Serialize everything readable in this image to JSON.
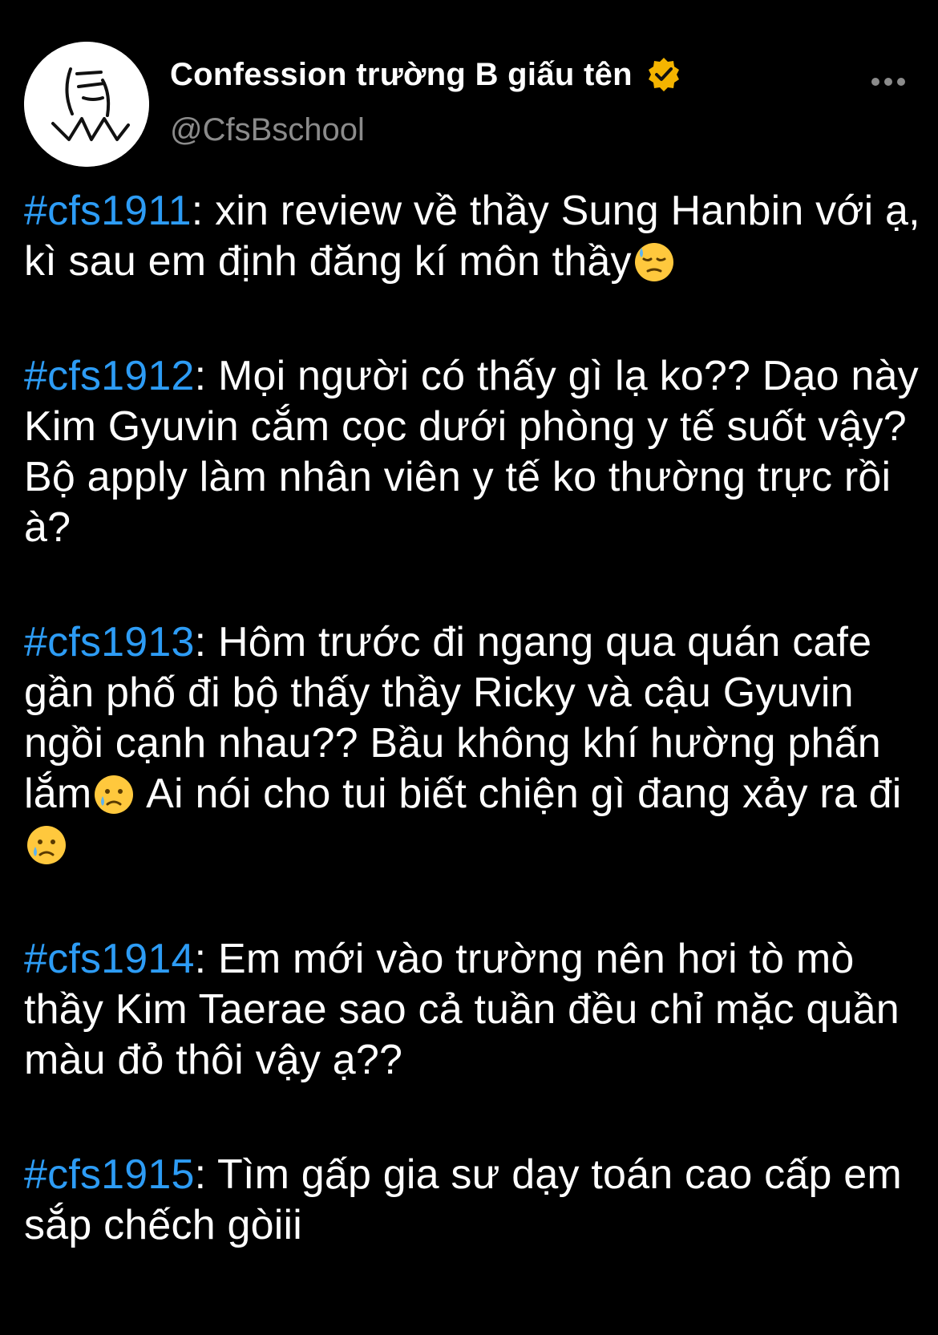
{
  "account": {
    "display_name": "Confession trường B giấu tên",
    "handle": "@CfsBschool",
    "verified_color": "#F4B400",
    "link_color": "#2D9CF5"
  },
  "icons": {
    "avatar": "doodle-face-avatar",
    "verified": "verified-badge-icon",
    "more": "more-options-icon",
    "emoji_sweat": "downcast-face-with-sweat-emoji",
    "emoji_sad": "sad-but-relieved-face-emoji"
  },
  "confessions": [
    {
      "tag": "#cfs1911",
      "part1": ": xin review về thầy Sung Hanbin với ạ, kì sau em định đăng kí môn thầy",
      "part2": "",
      "part3": ""
    },
    {
      "tag": "#cfs1912",
      "part1": ": Mọi người có thấy gì lạ ko?? Dạo này Kim Gyuvin cắm cọc dưới phòng y tế suốt vậy? Bộ apply làm nhân viên y tế ko thường trực rồi à?",
      "part2": "",
      "part3": ""
    },
    {
      "tag": "#cfs1913",
      "part1": ": Hôm trước đi ngang qua quán cafe gần phố đi bộ thấy thầy Ricky và cậu Gyuvin ngồi cạnh nhau?? Bầu không khí hường phấn lắm",
      "part2": "  Ai nói cho tui biết chiện gì đang xảy ra đi",
      "part3": ""
    },
    {
      "tag": "#cfs1914",
      "part1": ": Em mới vào trường nên hơi tò mò thầy Kim Taerae sao cả tuần đều chỉ mặc quần màu đỏ thôi vậy ạ??",
      "part2": "",
      "part3": ""
    },
    {
      "tag": "#cfs1915",
      "part1": ": Tìm gấp gia sư dạy toán cao cấp em sắp chếch gòiii",
      "part2": "",
      "part3": ""
    }
  ]
}
